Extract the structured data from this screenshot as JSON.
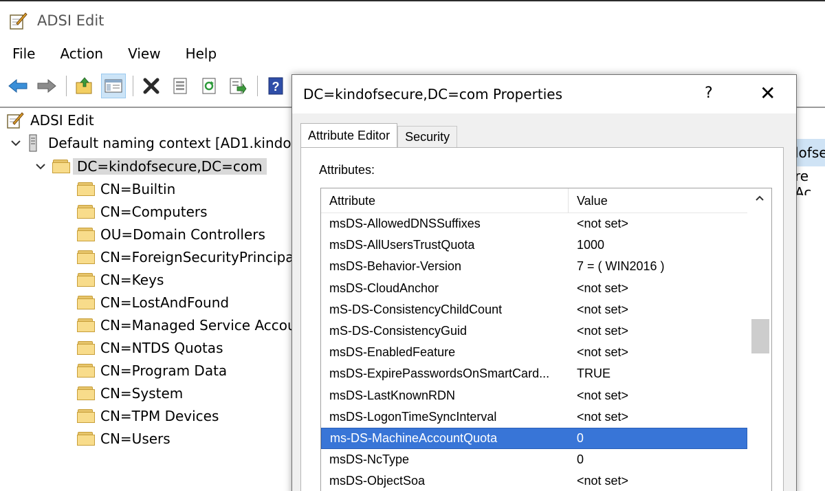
{
  "window": {
    "title": "ADSI Edit",
    "icon": "adsi-edit-icon"
  },
  "menu": [
    "File",
    "Action",
    "View",
    "Help"
  ],
  "toolbar": {
    "buttons": [
      {
        "name": "back-icon"
      },
      {
        "name": "forward-icon"
      },
      {
        "name": "up-folder-icon"
      },
      {
        "name": "show-hide-tree-icon"
      },
      {
        "name": "delete-icon"
      },
      {
        "name": "properties-icon"
      },
      {
        "name": "refresh-icon"
      },
      {
        "name": "export-list-icon"
      },
      {
        "name": "help-icon"
      }
    ]
  },
  "tree": {
    "root": "ADSI Edit",
    "context": "Default naming context [AD1.kindo",
    "domain": "DC=kindofsecure,DC=com",
    "children": [
      "CN=Builtin",
      "CN=Computers",
      "OU=Domain Controllers",
      "CN=ForeignSecurityPrincipa",
      "CN=Keys",
      "CN=LostAndFound",
      "CN=Managed Service Accou",
      "CN=NTDS Quotas",
      "CN=Program Data",
      "CN=System",
      "CN=TPM Devices",
      "CN=Users"
    ]
  },
  "right_pane": {
    "peek1": "lofse",
    "peek2": "re Ac"
  },
  "dialog": {
    "title": "DC=kindofsecure,DC=com Properties",
    "help": "?",
    "close": "✕",
    "tabs": [
      "Attribute Editor",
      "Security"
    ],
    "attributes_label": "Attributes:",
    "columns": [
      "Attribute",
      "Value"
    ],
    "rows": [
      {
        "attr": "msDS-AllowedDNSSuffixes",
        "value": "<not set>"
      },
      {
        "attr": "msDS-AllUsersTrustQuota",
        "value": "1000"
      },
      {
        "attr": "msDS-Behavior-Version",
        "value": "7 = ( WIN2016 )"
      },
      {
        "attr": "msDS-CloudAnchor",
        "value": "<not set>"
      },
      {
        "attr": "mS-DS-ConsistencyChildCount",
        "value": "<not set>"
      },
      {
        "attr": "mS-DS-ConsistencyGuid",
        "value": "<not set>"
      },
      {
        "attr": "msDS-EnabledFeature",
        "value": "<not set>"
      },
      {
        "attr": "msDS-ExpirePasswordsOnSmartCard...",
        "value": "TRUE"
      },
      {
        "attr": "msDS-LastKnownRDN",
        "value": "<not set>"
      },
      {
        "attr": "msDS-LogonTimeSyncInterval",
        "value": "<not set>"
      },
      {
        "attr": "ms-DS-MachineAccountQuota",
        "value": "0"
      },
      {
        "attr": "msDS-NcType",
        "value": "0"
      },
      {
        "attr": "msDS-ObjectSoa",
        "value": "<not set>"
      }
    ],
    "selected_row": 10
  },
  "colors": {
    "selection": "#3875d7",
    "tree_selection": "#d9d9d9",
    "toolbar_active": "#cce4f7"
  }
}
